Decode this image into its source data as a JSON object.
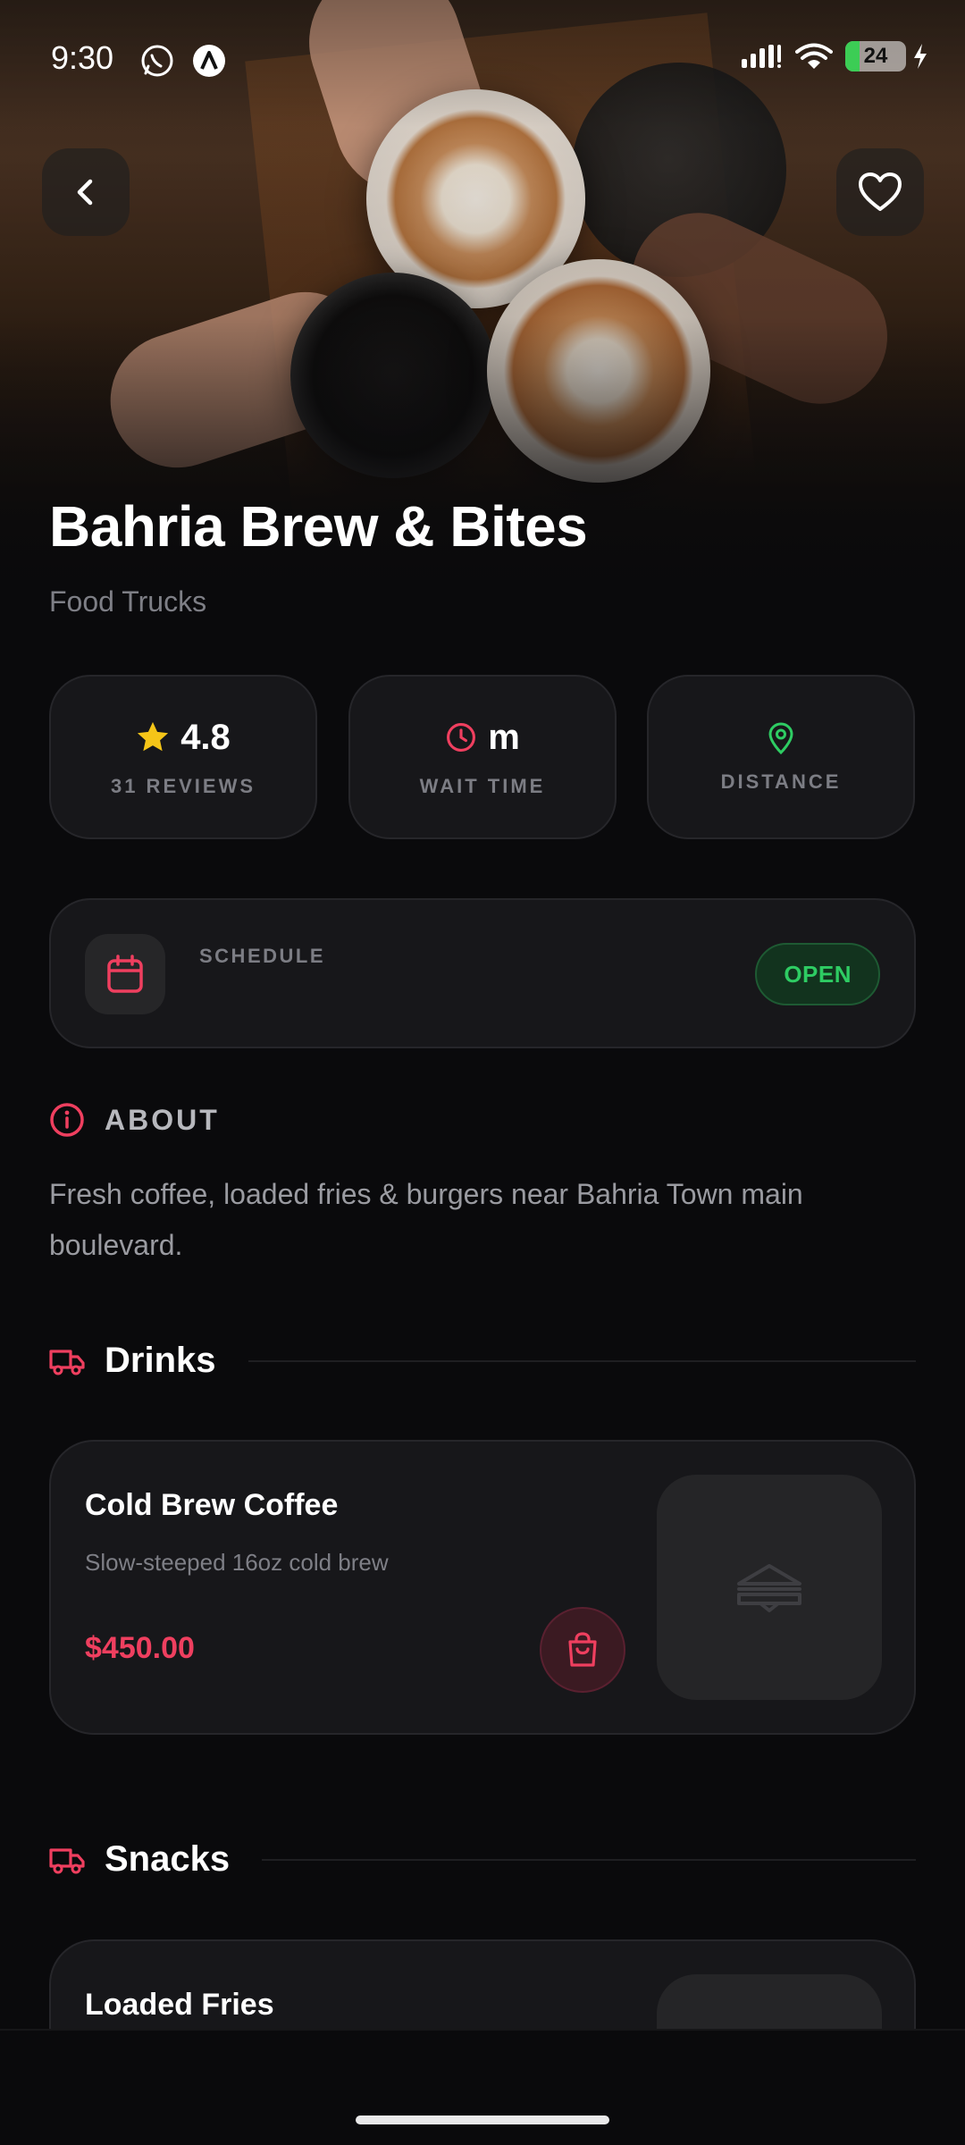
{
  "status_bar": {
    "time": "9:30",
    "battery": "24",
    "icons": [
      "whatsapp-icon",
      "app-notification-icon",
      "signal-icon",
      "wifi-icon",
      "battery-icon",
      "charging-icon"
    ]
  },
  "header": {
    "back_icon": "chevron-left-icon",
    "favorite_icon": "heart-icon",
    "hero_image": "coffee-cups-toast-photo"
  },
  "vendor": {
    "name": "Bahria Brew & Bites",
    "category": "Food Trucks"
  },
  "stats": {
    "rating": {
      "value": "4.8",
      "label": "31 REVIEWS",
      "icon": "star-icon"
    },
    "wait": {
      "value": "m",
      "label": "WAIT TIME",
      "icon": "clock-icon"
    },
    "distance": {
      "label": "DISTANCE",
      "icon": "location-pin-icon"
    }
  },
  "schedule": {
    "label": "SCHEDULE",
    "status": "OPEN",
    "icon": "calendar-icon"
  },
  "about": {
    "heading": "ABOUT",
    "text": "Fresh coffee, loaded fries & burgers near Bahria Town main boulevard.",
    "icon": "info-icon"
  },
  "menu": {
    "sections": [
      {
        "name": "Drinks",
        "icon": "truck-icon",
        "items": [
          {
            "name": "Cold Brew Coffee",
            "description": "Slow-steeped 16oz cold brew",
            "price": "$450.00"
          }
        ]
      },
      {
        "name": "Snacks",
        "icon": "truck-icon",
        "items": [
          {
            "name": "Loaded Fries"
          }
        ]
      }
    ]
  },
  "colors": {
    "accent": "#ef3f5f",
    "open_green": "#2ecc63",
    "star": "#f5c518",
    "background": "#0a0a0c",
    "card": "#17171a"
  }
}
